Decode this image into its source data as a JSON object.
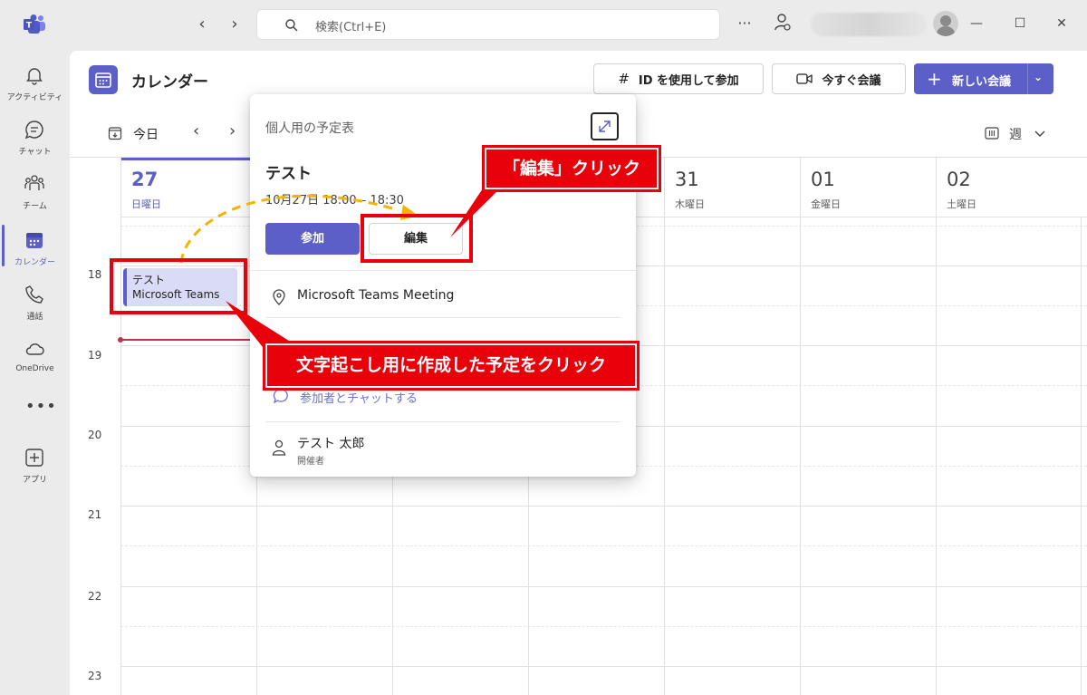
{
  "titlebar": {
    "search_placeholder": "検索(Ctrl+E)"
  },
  "rail": {
    "items": [
      {
        "label": "アクティビティ"
      },
      {
        "label": "チャット"
      },
      {
        "label": "チーム"
      },
      {
        "label": "カレンダー"
      },
      {
        "label": "通話"
      },
      {
        "label": "OneDrive"
      },
      {
        "label": "アプリ"
      }
    ],
    "more": "•••"
  },
  "header": {
    "title": "カレンダー",
    "join_id_label": "ID を使用して参加",
    "meet_now_label": "今すぐ会議",
    "new_meeting_label": "新しい会議"
  },
  "toolbar": {
    "today_label": "今日",
    "view_label": "週"
  },
  "days": [
    {
      "num": "27",
      "dow": "日曜日"
    },
    {
      "num": "31",
      "dow": "木曜日"
    },
    {
      "num": "01",
      "dow": "金曜日"
    },
    {
      "num": "02",
      "dow": "土曜日"
    }
  ],
  "hours": [
    "18",
    "19",
    "20",
    "21",
    "22",
    "23"
  ],
  "event": {
    "title": "テスト",
    "subtitle": "Microsoft Teams"
  },
  "popup": {
    "calendar_name": "個人用の予定表",
    "title": "テスト",
    "time": "10月27日 18:00 – 18:30",
    "join_label": "参加",
    "edit_label": "編集",
    "location": "Microsoft Teams Meeting",
    "chat_label": "参加者とチャットする",
    "organizer_name": "テスト 太郎",
    "organizer_role": "開催者"
  },
  "annotations": {
    "edit_callout": "「編集」クリック",
    "event_callout": "文字起こし用に作成した予定をクリック"
  },
  "colors": {
    "accent": "#5b5fc7",
    "annotation_red": "#e8000b",
    "arrow_yellow": "#f4b400"
  }
}
